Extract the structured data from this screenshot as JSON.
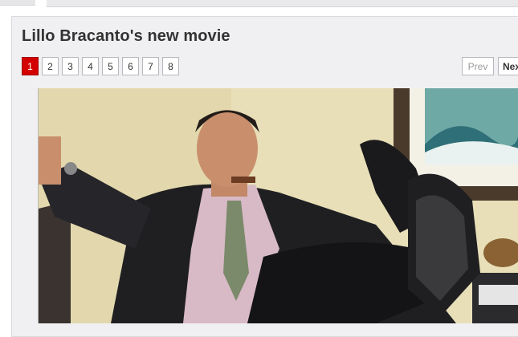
{
  "header": {
    "title": "Lillo Bracanto's new movie"
  },
  "pagination": {
    "pages": [
      "1",
      "2",
      "3",
      "4",
      "5",
      "6",
      "7",
      "8"
    ],
    "active_page": "1",
    "prev_label": "Prev",
    "next_label": "Nex"
  },
  "photo": {
    "subject": "man in suit with feet on desk, cigar in mouth",
    "colors": {
      "wall": "#e8dfb8",
      "suit": "#1f1f22",
      "shirt": "#d8b9c6",
      "tie": "#7b8a6a",
      "skin": "#c98f6d"
    }
  },
  "colors": {
    "active_page_bg": "#d40000",
    "panel_bg": "#f0f0f3"
  }
}
